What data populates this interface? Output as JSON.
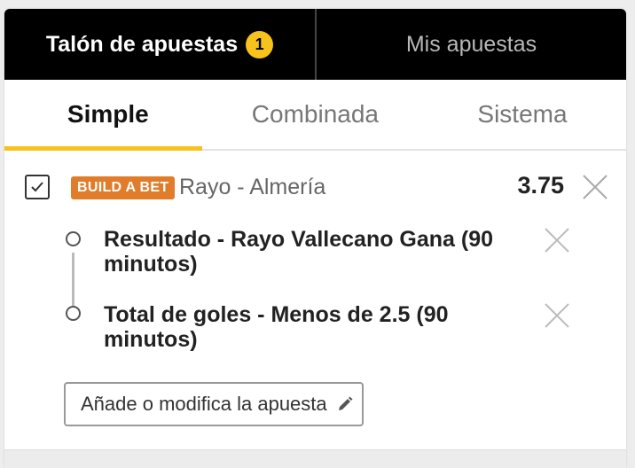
{
  "top_tabs": {
    "betslip_label": "Talón de apuestas",
    "betslip_count": "1",
    "my_bets_label": "Mis apuestas"
  },
  "sub_tabs": {
    "simple": "Simple",
    "combined": "Combinada",
    "system": "Sistema"
  },
  "bet": {
    "checked": true,
    "tag": "BUILD A BET",
    "match": "Rayo - Almería",
    "odds": "3.75",
    "selections": [
      {
        "text": "Resultado - Rayo Vallecano Gana (90 minutos)"
      },
      {
        "text": "Total de goles - Menos de 2.5 (90 minutos)"
      }
    ],
    "edit_button": "Añade o modifica la apuesta"
  },
  "colors": {
    "accent": "#f6c21c",
    "tag": "#e07c2a",
    "header_bg": "#000000"
  },
  "icons": [
    "checkmark-icon",
    "close-icon",
    "pencil-icon"
  ]
}
